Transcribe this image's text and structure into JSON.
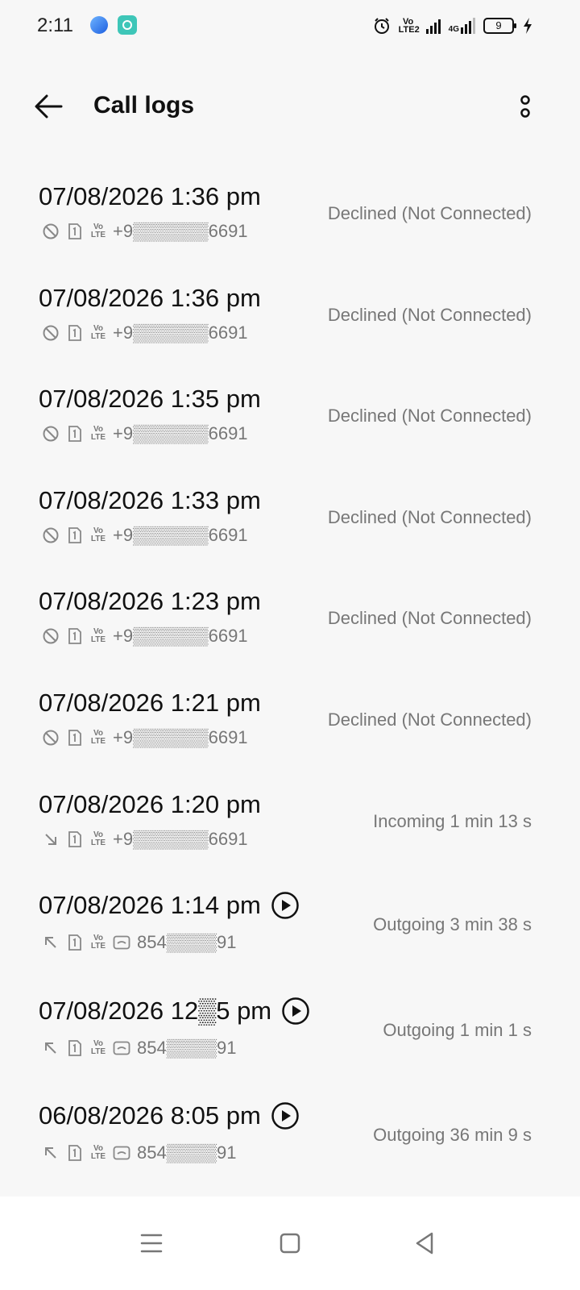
{
  "status_bar": {
    "time": "2:11",
    "volte_label": "Vo LTE2",
    "network_label": "4G",
    "battery_level": "9"
  },
  "header": {
    "title": "Call logs"
  },
  "logs": [
    {
      "datetime": "07/08/2026 1:36 pm",
      "number": "+9▒▒▒▒▒▒6691",
      "status": "Declined (Not Connected)",
      "type": "declined",
      "recording": false
    },
    {
      "datetime": "07/08/2026 1:36 pm",
      "number": "+9▒▒▒▒▒▒6691",
      "status": "Declined (Not Connected)",
      "type": "declined",
      "recording": false
    },
    {
      "datetime": "07/08/2026 1:35 pm",
      "number": "+9▒▒▒▒▒▒6691",
      "status": "Declined (Not Connected)",
      "type": "declined",
      "recording": false
    },
    {
      "datetime": "07/08/2026 1:33 pm",
      "number": "+9▒▒▒▒▒▒6691",
      "status": "Declined (Not Connected)",
      "type": "declined",
      "recording": false
    },
    {
      "datetime": "07/08/2026 1:23 pm",
      "number": "+9▒▒▒▒▒▒6691",
      "status": "Declined (Not Connected)",
      "type": "declined",
      "recording": false
    },
    {
      "datetime": "07/08/2026 1:21 pm",
      "number": "+9▒▒▒▒▒▒6691",
      "status": "Declined (Not Connected)",
      "type": "declined",
      "recording": false
    },
    {
      "datetime": "07/08/2026 1:20 pm",
      "number": "+9▒▒▒▒▒▒6691",
      "status": "Incoming  1 min 13 s",
      "type": "incoming",
      "recording": false
    },
    {
      "datetime": "07/08/2026 1:14 pm",
      "number": "854▒▒▒▒91",
      "status": "Outgoing  3 min 38 s",
      "type": "outgoing",
      "recording": true
    },
    {
      "datetime": "07/08/2026 12▒5 pm",
      "number": "854▒▒▒▒91",
      "status": "Outgoing  1 min 1 s",
      "type": "outgoing",
      "recording": true
    },
    {
      "datetime": "06/08/2026 8:05 pm",
      "number": "854▒▒▒▒91",
      "status": "Outgoing  36 min 9 s",
      "type": "outgoing",
      "recording": true
    }
  ],
  "icons": {
    "declined": "block-icon",
    "incoming": "incoming-arrow-icon",
    "outgoing": "outgoing-arrow-icon",
    "sim": "sim-1-icon",
    "volte": "volte-icon",
    "contact": "contact-card-icon",
    "play": "play-recording-icon"
  },
  "colors": {
    "background": "#f7f7f7",
    "secondary_text": "#777777",
    "primary_text": "#111111"
  }
}
